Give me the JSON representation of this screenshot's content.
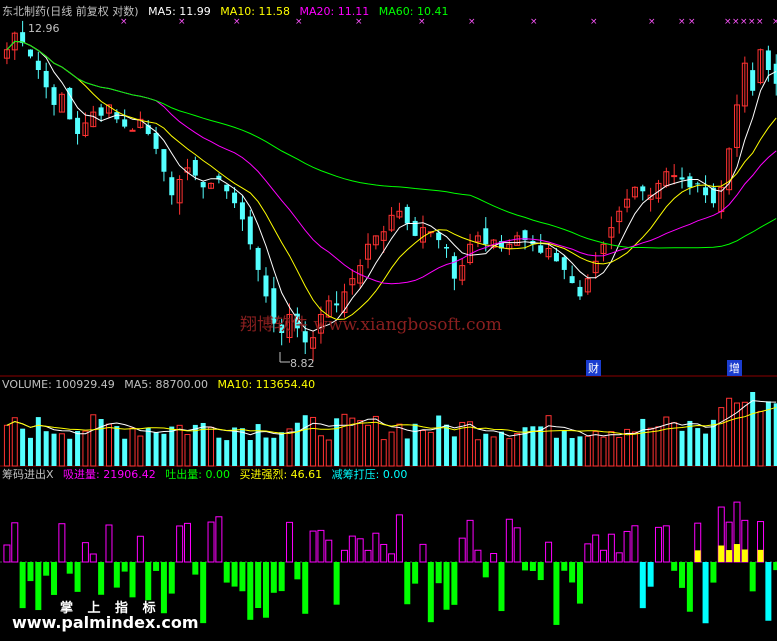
{
  "colors": {
    "bg": "#000000",
    "up": "#ff3232",
    "down": "#54ffff",
    "ma5": "#ffffff",
    "ma10": "#ffff00",
    "ma20": "#ff00ff",
    "ma60": "#00ff00",
    "panel_line": "#8b0000",
    "absorb": "#ff00ff",
    "spit": "#00ff00",
    "strong": "#ffff00",
    "reduce": "#00ffff"
  },
  "price_panel": {
    "title": "东北制药(日线 前复权 对数)",
    "ma5": "MA5: 11.99",
    "ma10": "MA10: 11.58",
    "ma20": "MA20: 11.11",
    "ma60": "MA60: 10.41",
    "high_label": "12.96",
    "low_label": "8.82",
    "event_labels": [
      "财",
      "增"
    ]
  },
  "volume_panel": {
    "volume": "VOLUME: 100929.49",
    "ma5": "MA5: 88700.00",
    "ma10": "MA10: 113654.40"
  },
  "indicator_panel": {
    "name": "筹码进出X",
    "absorb": "吸进量: 21906.42",
    "spit": "吐出量: 0.00",
    "strong": "买进强烈: 46.61",
    "reduce": "减筹打压: 0.00"
  },
  "watermarks": {
    "main": "翔博软件 www.xiangbosoft.com",
    "brand": "掌 上 指 标",
    "site": "www.palmindex.com"
  },
  "chart_data": {
    "type": "candlestick",
    "price_min": 8.82,
    "price_max": 12.96,
    "scale": "log",
    "closes": [
      12.6,
      12.85,
      12.7,
      12.5,
      12.3,
      12.05,
      11.8,
      11.95,
      11.6,
      11.4,
      11.55,
      11.7,
      11.65,
      11.8,
      11.6,
      11.5,
      11.45,
      11.6,
      11.4,
      11.2,
      10.9,
      10.6,
      10.8,
      10.95,
      10.85,
      10.7,
      10.75,
      10.8,
      10.65,
      10.5,
      10.3,
      10.0,
      9.7,
      9.4,
      9.1,
      9.0,
      9.2,
      9.05,
      8.9,
      8.95,
      9.2,
      9.35,
      9.3,
      9.45,
      9.6,
      9.75,
      10.0,
      10.1,
      10.15,
      10.35,
      10.4,
      10.25,
      10.1,
      10.2,
      10.15,
      10.05,
      9.95,
      9.6,
      9.75,
      10.0,
      10.1,
      10.0,
      10.05,
      9.95,
      10.0,
      10.1,
      10.05,
      10.0,
      9.9,
      9.95,
      9.8,
      9.7,
      9.55,
      9.4,
      9.6,
      9.8,
      10.0,
      10.2,
      10.4,
      10.55,
      10.7,
      10.65,
      10.6,
      10.75,
      10.9,
      10.85,
      10.8,
      10.7,
      10.75,
      10.6,
      10.5,
      10.7,
      11.2,
      11.8,
      12.4,
      12.0,
      12.6,
      12.3,
      12.1
    ]
  }
}
